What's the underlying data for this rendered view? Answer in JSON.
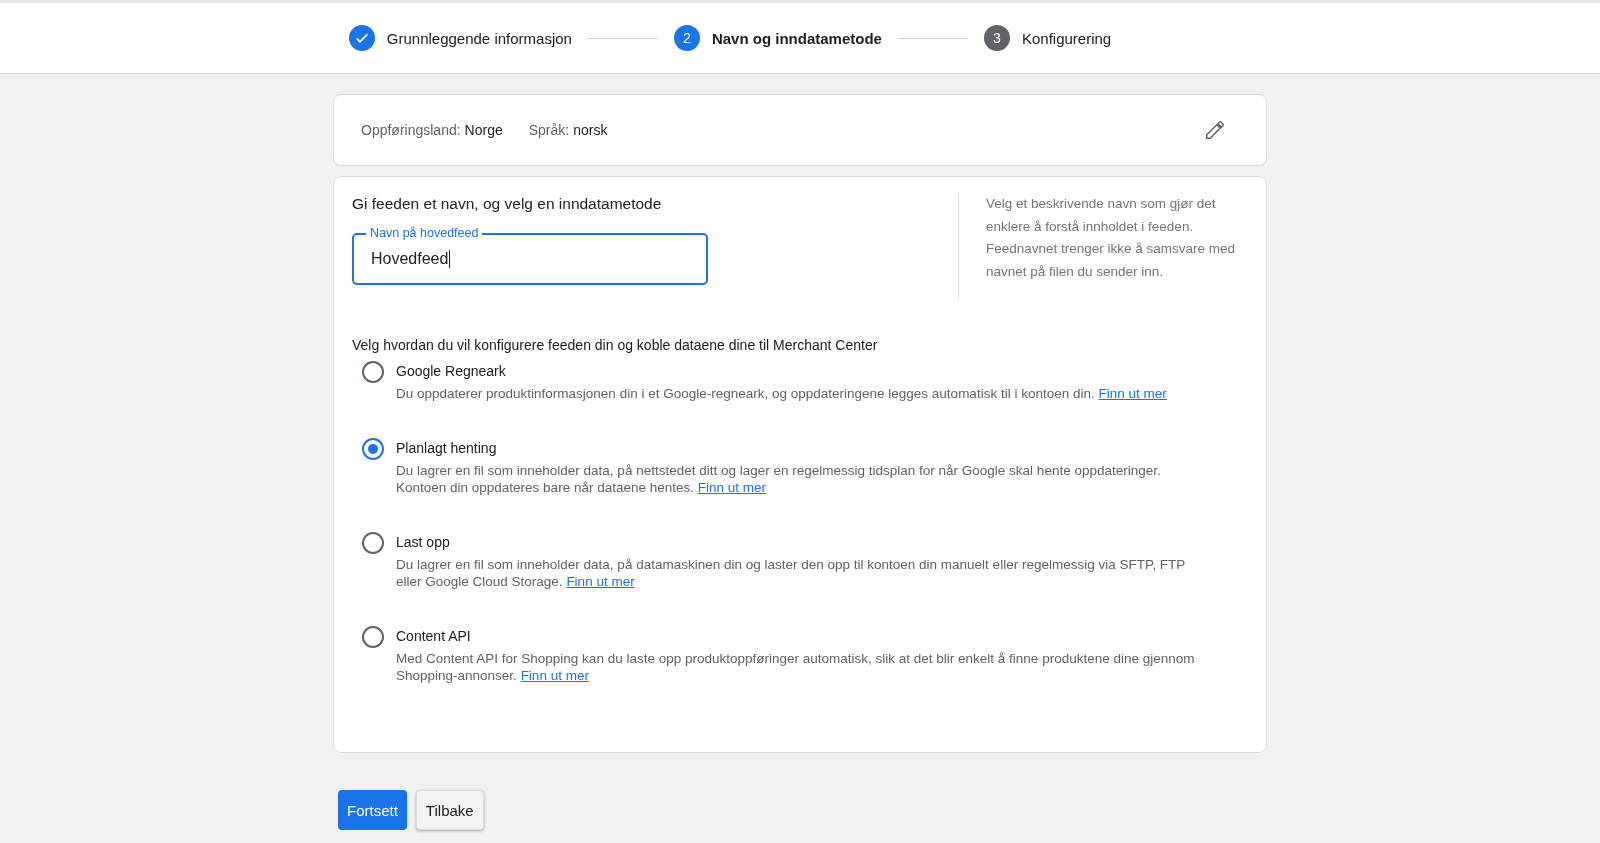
{
  "stepper": [
    {
      "label": "Grunnleggende informasjon",
      "kind": "done"
    },
    {
      "label": "Navn og inndatametode",
      "number": "2",
      "kind": "current"
    },
    {
      "label": "Konfigurering",
      "number": "3",
      "kind": "upcoming"
    }
  ],
  "summary": {
    "items": [
      {
        "label": "Oppføringsland:",
        "value": "Norge"
      },
      {
        "label": "Språk:",
        "value": "norsk"
      }
    ]
  },
  "name_section": {
    "title": "Gi feeden et navn, og velg en inndatametode",
    "field": {
      "label": "Navn på hovedfeed",
      "value": "Hovedfeed"
    },
    "help": "Velg et beskrivende navn som gjør det enklere å forstå innholdet i feeden. Feednavnet trenger ikke å samsvare med navnet på filen du sender inn."
  },
  "method_section": {
    "title": "Velg hvordan du vil konfigurere feeden din og koble dataene dine til Merchant Center",
    "options": [
      {
        "label": "Google Regneark",
        "selected": false,
        "description": "Du oppdaterer produktinformasjonen din i et Google-regneark, og oppdateringene legges automatisk til i kontoen din.",
        "link": "Finn ut mer"
      },
      {
        "label": "Planlagt henting",
        "selected": true,
        "description": "Du lagrer en fil som inneholder data, på nettstedet ditt og lager en regelmessig tidsplan for når Google skal hente oppdateringer. Kontoen din oppdateres bare når dataene hentes.",
        "link": "Finn ut mer"
      },
      {
        "label": "Last opp",
        "selected": false,
        "description": "Du lagrer en fil som inneholder data, på datamaskinen din og laster den opp til kontoen din manuelt eller regelmessig via SFTP, FTP eller Google Cloud Storage.",
        "link": "Finn ut mer"
      },
      {
        "label": "Content API",
        "selected": false,
        "description": "Med Content API for Shopping kan du laste opp produktoppføringer automatisk, slik at det blir enkelt å finne produktene dine gjennom Shopping-annonser.",
        "link": "Finn ut mer"
      }
    ]
  },
  "buttons": [
    {
      "label": "Fortsett",
      "kind": "primary"
    },
    {
      "label": "Tilbake",
      "kind": "secondary"
    }
  ]
}
